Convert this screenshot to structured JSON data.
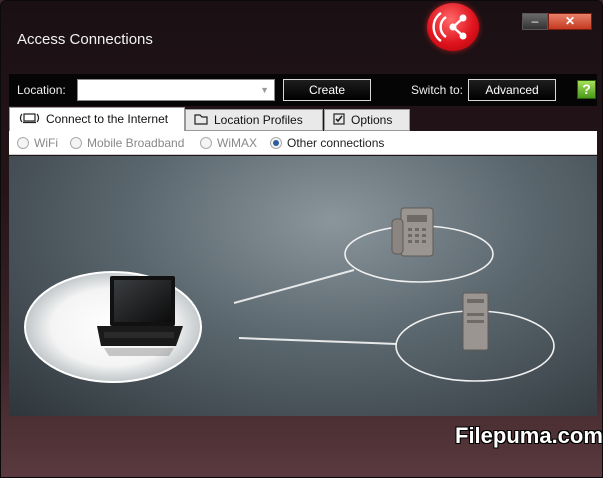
{
  "window": {
    "title": "Access Connections",
    "minimize_glyph": "–",
    "close_glyph": "✕"
  },
  "toolbar": {
    "location_label": "Location:",
    "location_value": "",
    "create_label": "Create",
    "switch_label": "Switch to:",
    "advanced_label": "Advanced",
    "help_glyph": "?"
  },
  "tabs": [
    {
      "label": "Connect to the Internet",
      "icon": "laptop-signal-icon",
      "active": true
    },
    {
      "label": "Location Profiles",
      "icon": "folder-icon",
      "active": false
    },
    {
      "label": "Options",
      "icon": "checkbox-icon",
      "active": false
    }
  ],
  "connection_types": [
    {
      "label": "WiFi",
      "selected": false
    },
    {
      "label": "Mobile Broadband",
      "selected": false
    },
    {
      "label": "WiMAX",
      "selected": false
    },
    {
      "label": "Other connections",
      "selected": true
    }
  ],
  "diagram": {
    "nodes": [
      {
        "name": "laptop",
        "icon": "laptop-icon"
      },
      {
        "name": "phone",
        "icon": "phone-modem-icon"
      },
      {
        "name": "server",
        "icon": "server-icon"
      }
    ]
  },
  "watermark": "Filepuma.com",
  "colors": {
    "logo": "#e0141e",
    "accent": "#2a5d9a",
    "help": "#6cbf2a"
  }
}
